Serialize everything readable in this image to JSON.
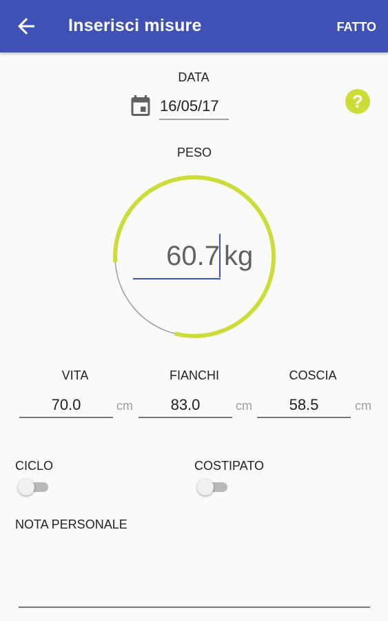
{
  "appbar": {
    "title": "Inserisci misure",
    "done_label": "FATTO",
    "back_icon": "arrow-back-icon",
    "color": "#3f51b5"
  },
  "date": {
    "label": "DATA",
    "value": "16/05/17",
    "icon": "calendar-icon"
  },
  "help": {
    "icon": "help-circle-icon",
    "color": "#cddc39"
  },
  "weight": {
    "label": "PESO",
    "value": "60.7",
    "unit": "kg",
    "gauge_fraction": 0.8,
    "gauge_color": "#cddc39"
  },
  "measures": [
    {
      "label": "VITA",
      "value": "70.0",
      "unit": "cm"
    },
    {
      "label": "FIANCHI",
      "value": "83.0",
      "unit": "cm"
    },
    {
      "label": "COSCIA",
      "value": "58.5",
      "unit": "cm"
    }
  ],
  "toggles": [
    {
      "label": "CICLO",
      "on": false
    },
    {
      "label": "COSTIPATO",
      "on": false
    }
  ],
  "note": {
    "label": "NOTA PERSONALE",
    "value": ""
  }
}
